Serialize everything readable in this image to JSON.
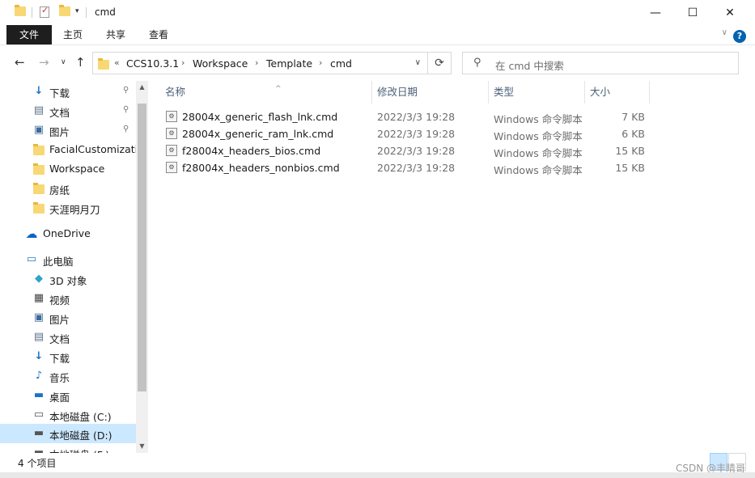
{
  "window": {
    "title": "cmd",
    "minimize_glyph": "—",
    "maximize_glyph": "☐",
    "close_glyph": "✕"
  },
  "ribbon": {
    "tabs": [
      "文件",
      "主页",
      "共享",
      "查看"
    ],
    "expand_glyph": "∨",
    "help_glyph": "?"
  },
  "nav": {
    "back_glyph": "←",
    "forward_glyph": "→",
    "history_glyph": "∨",
    "up_glyph": "↑"
  },
  "address": {
    "overflow": "«",
    "crumbs": [
      "CCS10.3.1",
      "Workspace",
      "Template",
      "cmd"
    ],
    "separator": "›",
    "dropdown_glyph": "∨",
    "refresh_glyph": "⟳"
  },
  "search": {
    "placeholder": "在 cmd 中搜索",
    "icon": "search-icon"
  },
  "sidebar": {
    "quick_access": [
      {
        "label": "下载",
        "icon": "download-arrow-icon",
        "pinned": true
      },
      {
        "label": "文档",
        "icon": "document-icon",
        "pinned": true
      },
      {
        "label": "图片",
        "icon": "pictures-icon",
        "pinned": true
      },
      {
        "label": "FacialCustomizatio",
        "icon": "folder-icon",
        "pinned": false
      },
      {
        "label": "Workspace",
        "icon": "folder-icon",
        "pinned": false
      },
      {
        "label": "房纸",
        "icon": "folder-icon",
        "pinned": false
      },
      {
        "label": "天涯明月刀",
        "icon": "folder-icon",
        "pinned": false
      }
    ],
    "onedrive": {
      "label": "OneDrive",
      "icon": "cloud-icon"
    },
    "this_pc": {
      "label": "此电脑",
      "icon": "computer-icon"
    },
    "pc_items": [
      {
        "label": "3D 对象",
        "icon": "3d-objects-icon"
      },
      {
        "label": "视频",
        "icon": "video-icon"
      },
      {
        "label": "图片",
        "icon": "pictures-icon"
      },
      {
        "label": "文档",
        "icon": "document-icon"
      },
      {
        "label": "下载",
        "icon": "download-arrow-icon"
      },
      {
        "label": "音乐",
        "icon": "music-note-icon"
      },
      {
        "label": "桌面",
        "icon": "desktop-icon"
      },
      {
        "label": "本地磁盘 (C:)",
        "icon": "drive-c-icon"
      },
      {
        "label": "本地磁盘 (D:)",
        "icon": "drive-icon",
        "selected": true
      },
      {
        "label": "本地磁盘 (F:)",
        "icon": "drive-icon"
      }
    ],
    "pin_glyph": "📌"
  },
  "columns": {
    "name": "名称",
    "date": "修改日期",
    "type": "类型",
    "size": "大小",
    "sort_glyph": "^"
  },
  "files": [
    {
      "name": "28004x_generic_flash_lnk.cmd",
      "date": "2022/3/3 19:28",
      "type": "Windows 命令脚本",
      "size": "7 KB"
    },
    {
      "name": "28004x_generic_ram_lnk.cmd",
      "date": "2022/3/3 19:28",
      "type": "Windows 命令脚本",
      "size": "6 KB"
    },
    {
      "name": "f28004x_headers_bios.cmd",
      "date": "2022/3/3 19:28",
      "type": "Windows 命令脚本",
      "size": "15 KB"
    },
    {
      "name": "f28004x_headers_nonbios.cmd",
      "date": "2022/3/3 19:28",
      "type": "Windows 命令脚本",
      "size": "15 KB"
    }
  ],
  "status": {
    "count": "4 个项目"
  },
  "watermark": "CSDN @丰睛哥",
  "colors": {
    "selected_bg": "#cce8ff",
    "file_tab_bg": "#1e1e1e",
    "folder": "#f8d775",
    "accent": "#0063b1"
  }
}
